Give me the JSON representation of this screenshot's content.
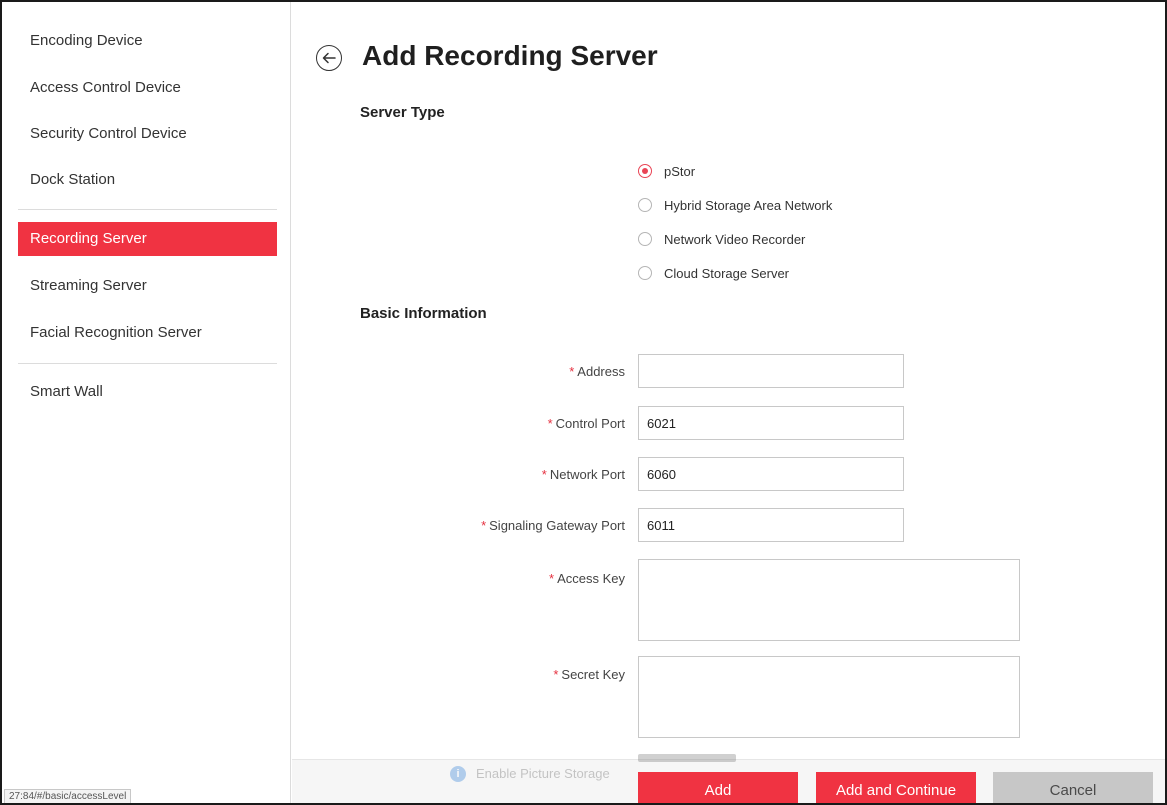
{
  "sidebar": {
    "items": [
      {
        "label": "Encoding Device"
      },
      {
        "label": "Access Control Device"
      },
      {
        "label": "Security Control Device"
      },
      {
        "label": "Dock Station"
      },
      {
        "label": "Recording Server"
      },
      {
        "label": "Streaming Server"
      },
      {
        "label": "Facial Recognition Server"
      },
      {
        "label": "Smart Wall"
      }
    ],
    "active_index": 4
  },
  "header": {
    "title": "Add Recording Server",
    "back_icon": "arrow-left-circle-icon"
  },
  "server_type": {
    "title": "Server Type",
    "options": [
      {
        "label": "pStor",
        "checked": true
      },
      {
        "label": "Hybrid Storage Area Network",
        "checked": false
      },
      {
        "label": "Network Video Recorder",
        "checked": false
      },
      {
        "label": "Cloud Storage Server",
        "checked": false
      }
    ]
  },
  "basic_info": {
    "title": "Basic Information",
    "address": {
      "label": "Address",
      "value": ""
    },
    "control_port": {
      "label": "Control Port",
      "value": "6021"
    },
    "network_port": {
      "label": "Network Port",
      "value": "6060"
    },
    "signaling_port": {
      "label": "Signaling Gateway Port",
      "value": "6011"
    },
    "access_key": {
      "label": "Access Key",
      "value": ""
    },
    "secret_key": {
      "label": "Secret Key",
      "value": ""
    },
    "required_mark": "*"
  },
  "picture_storage": {
    "label": "Enable Picture Storage",
    "icon": "info-icon"
  },
  "actions": {
    "add": "Add",
    "add_continue": "Add and Continue",
    "cancel": "Cancel"
  },
  "status_url": "27:84/#/basic/accessLevel",
  "colors": {
    "accent": "#f03342",
    "cancel_bg": "#c7c7c7"
  }
}
